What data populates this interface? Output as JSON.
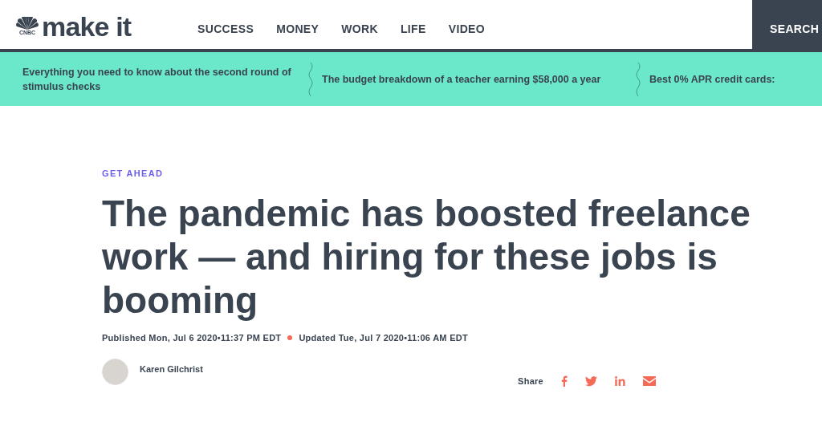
{
  "logo": {
    "network": "CNBC",
    "brand": "make it"
  },
  "nav": [
    "SUCCESS",
    "MONEY",
    "WORK",
    "LIFE",
    "VIDEO"
  ],
  "search": {
    "label": "SEARCH"
  },
  "headlines": [
    "Everything you need to know about the second round of stimulus checks",
    "The budget breakdown of a teacher earning $58,000 a year",
    "Best 0% APR credit cards:"
  ],
  "article": {
    "kicker": "GET AHEAD",
    "title": "The pandemic has boosted freelance work — and hiring for these jobs is booming",
    "published": "Published Mon, Jul 6 2020•11:37 PM EDT",
    "updated": "Updated Tue, Jul 7 2020•11:06 AM EDT",
    "author": "Karen Gilchrist"
  },
  "share": {
    "label": "Share",
    "networks": [
      {
        "kind": "facebook"
      },
      {
        "kind": "twitter"
      },
      {
        "kind": "linkedin"
      },
      {
        "kind": "email"
      }
    ]
  }
}
